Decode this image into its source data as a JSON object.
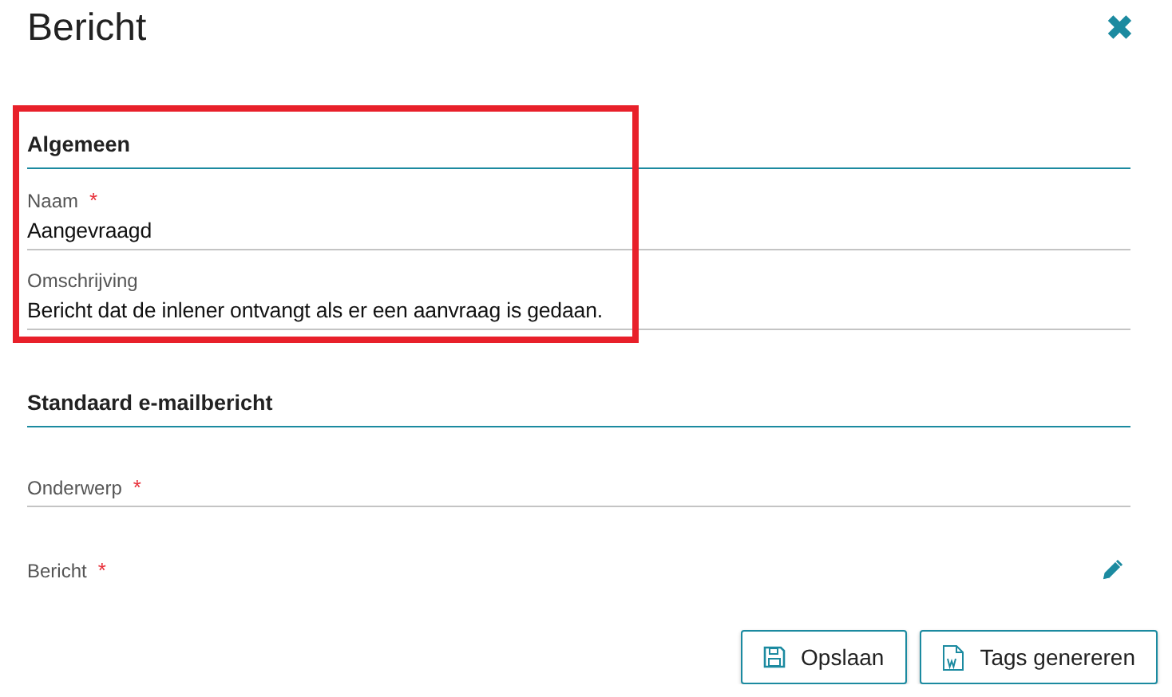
{
  "dialog": {
    "title": "Bericht",
    "close_icon": "✖"
  },
  "sections": [
    {
      "title": "Algemeen",
      "highlighted": true,
      "fields": [
        {
          "kind": "text",
          "label": "Naam",
          "required_mark": "*",
          "value": "Aangevraagd"
        },
        {
          "kind": "text",
          "label": "Omschrijving",
          "value": "Bericht dat de inlener ontvangt als er een aanvraag is gedaan."
        }
      ]
    },
    {
      "title": "Standaard e-mailbericht",
      "highlighted": false,
      "fields": [
        {
          "kind": "text",
          "label": "Onderwerp",
          "required_mark": "*"
        },
        {
          "kind": "editor",
          "label": "Bericht",
          "required_mark": "*"
        }
      ]
    }
  ],
  "buttons": [
    {
      "kind": "save",
      "label": "Opslaan"
    },
    {
      "kind": "word",
      "label": "Tags genereren"
    }
  ]
}
